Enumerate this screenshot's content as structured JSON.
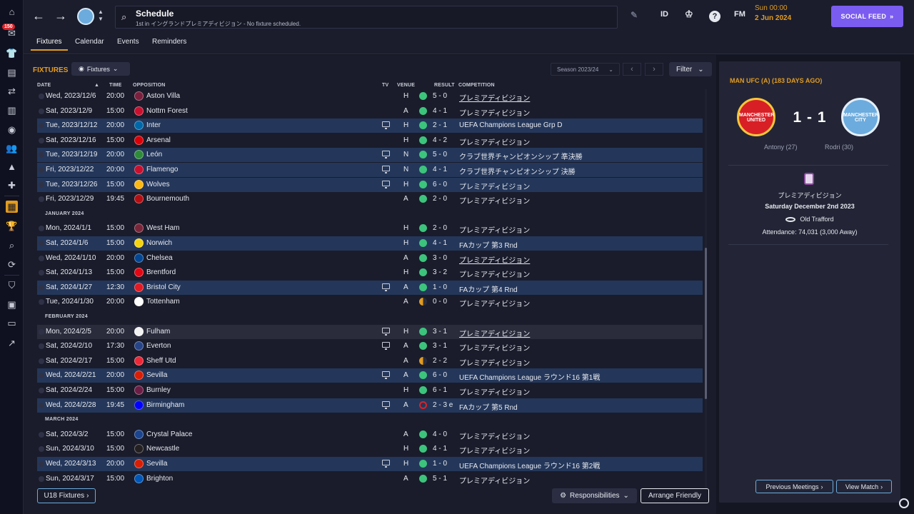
{
  "header": {
    "title": "Schedule",
    "subtitle": "1st in イングランドプレミアディビジョン - No fixture scheduled.",
    "lang_code": "ID",
    "fm_label": "FM",
    "date_day": "Sun 00:00",
    "date_full": "2 Jun 2024",
    "social_label": "SOCIAL FEED",
    "notification_count": "150"
  },
  "tabs": [
    "Fixtures",
    "Calendar",
    "Events",
    "Reminders"
  ],
  "toolbar": {
    "section_title": "FIXTURES",
    "view_label": "Fixtures",
    "season_label": "Season 2023/24",
    "filter_label": "Filter"
  },
  "columns": [
    "DATE",
    "TIME",
    "OPPOSITION",
    "TV",
    "VENUE",
    "RESULT",
    "COMPETITION"
  ],
  "months": [
    "JANUARY 2024",
    "FEBRUARY 2024",
    "MARCH 2024"
  ],
  "fixtures": [
    {
      "date": "Wed, 2023/12/6",
      "time": "20:00",
      "opp": "Aston Villa",
      "tv": false,
      "venue": "H",
      "result": "5 - 0",
      "outcome": "win",
      "comp": "プレミアディビジョン",
      "link": true,
      "crest": "#7a1f3d"
    },
    {
      "date": "Sat, 2023/12/9",
      "time": "15:00",
      "opp": "Nottm Forest",
      "tv": false,
      "venue": "A",
      "result": "4 - 1",
      "outcome": "win",
      "comp": "プレミアディビジョン",
      "link": false,
      "crest": "#c8102e"
    },
    {
      "date": "Tue, 2023/12/12",
      "time": "20:00",
      "opp": "Inter",
      "tv": true,
      "venue": "H",
      "result": "2 - 1",
      "outcome": "win",
      "comp": "UEFA Champions League Grp D",
      "link": false,
      "crest": "#0068a8"
    },
    {
      "date": "Sat, 2023/12/16",
      "time": "15:00",
      "opp": "Arsenal",
      "tv": false,
      "venue": "H",
      "result": "4 - 2",
      "outcome": "win",
      "comp": "プレミアディビジョン",
      "link": false,
      "crest": "#db0007"
    },
    {
      "date": "Tue, 2023/12/19",
      "time": "20:00",
      "opp": "León",
      "tv": true,
      "venue": "N",
      "result": "5 - 0",
      "outcome": "win",
      "comp": "クラブ世界チャンピオンシップ 準決勝",
      "link": false,
      "crest": "#2e8b3a"
    },
    {
      "date": "Fri, 2023/12/22",
      "time": "20:00",
      "opp": "Flamengo",
      "tv": true,
      "venue": "N",
      "result": "4 - 1",
      "outcome": "win",
      "comp": "クラブ世界チャンピオンシップ 決勝",
      "link": false,
      "crest": "#c8102e"
    },
    {
      "date": "Tue, 2023/12/26",
      "time": "15:00",
      "opp": "Wolves",
      "tv": true,
      "venue": "H",
      "result": "6 - 0",
      "outcome": "win",
      "comp": "プレミアディビジョン",
      "link": false,
      "crest": "#fdb913"
    },
    {
      "date": "Fri, 2023/12/29",
      "time": "19:45",
      "opp": "Bournemouth",
      "tv": false,
      "venue": "A",
      "result": "2 - 0",
      "outcome": "win",
      "comp": "プレミアディビジョン",
      "link": false,
      "crest": "#b50e12"
    },
    {
      "date": "Mon, 2024/1/1",
      "time": "15:00",
      "opp": "West Ham",
      "tv": false,
      "venue": "H",
      "result": "2 - 0",
      "outcome": "win",
      "comp": "プレミアディビジョン",
      "link": false,
      "crest": "#7a263a"
    },
    {
      "date": "Sat, 2024/1/6",
      "time": "15:00",
      "opp": "Norwich",
      "tv": false,
      "venue": "H",
      "result": "4 - 1",
      "outcome": "win",
      "comp": "FAカップ 第3 Rnd",
      "link": false,
      "crest": "#f5d40f"
    },
    {
      "date": "Wed, 2024/1/10",
      "time": "20:00",
      "opp": "Chelsea",
      "tv": false,
      "venue": "A",
      "result": "3 - 0",
      "outcome": "win",
      "comp": "プレミアディビジョン",
      "link": true,
      "crest": "#034694"
    },
    {
      "date": "Sat, 2024/1/13",
      "time": "15:00",
      "opp": "Brentford",
      "tv": false,
      "venue": "H",
      "result": "3 - 2",
      "outcome": "win",
      "comp": "プレミアディビジョン",
      "link": false,
      "crest": "#e30613"
    },
    {
      "date": "Sat, 2024/1/27",
      "time": "12:30",
      "opp": "Bristol City",
      "tv": true,
      "venue": "A",
      "result": "1 - 0",
      "outcome": "win",
      "comp": "FAカップ 第4 Rnd",
      "link": false,
      "crest": "#e21a23"
    },
    {
      "date": "Tue, 2024/1/30",
      "time": "20:00",
      "opp": "Tottenham",
      "tv": false,
      "venue": "A",
      "result": "0 - 0",
      "outcome": "draw",
      "comp": "プレミアディビジョン",
      "link": false,
      "crest": "#ffffff"
    },
    {
      "date": "Mon, 2024/2/5",
      "time": "20:00",
      "opp": "Fulham",
      "tv": true,
      "venue": "H",
      "result": "3 - 1",
      "outcome": "win",
      "comp": "プレミアディビジョン",
      "link": true,
      "crest": "#f2f2f2"
    },
    {
      "date": "Sat, 2024/2/10",
      "time": "17:30",
      "opp": "Everton",
      "tv": true,
      "venue": "A",
      "result": "3 - 1",
      "outcome": "win",
      "comp": "プレミアディビジョン",
      "link": false,
      "crest": "#274488"
    },
    {
      "date": "Sat, 2024/2/17",
      "time": "15:00",
      "opp": "Sheff Utd",
      "tv": false,
      "venue": "A",
      "result": "2 - 2",
      "outcome": "draw",
      "comp": "プレミアディビジョン",
      "link": false,
      "crest": "#ee2737"
    },
    {
      "date": "Wed, 2024/2/21",
      "time": "20:00",
      "opp": "Sevilla",
      "tv": true,
      "venue": "A",
      "result": "6 - 0",
      "outcome": "win",
      "comp": "UEFA Champions League ラウンド16 第1戦",
      "link": false,
      "crest": "#d81e05"
    },
    {
      "date": "Sat, 2024/2/24",
      "time": "15:00",
      "opp": "Burnley",
      "tv": false,
      "venue": "H",
      "result": "6 - 1",
      "outcome": "win",
      "comp": "プレミアディビジョン",
      "link": false,
      "crest": "#6c1d45"
    },
    {
      "date": "Wed, 2024/2/28",
      "time": "19:45",
      "opp": "Birmingham",
      "tv": true,
      "venue": "A",
      "result": "2 - 3 e",
      "outcome": "loss",
      "comp": "FAカップ 第5 Rnd",
      "link": false,
      "crest": "#0000ff"
    },
    {
      "date": "Sat, 2024/3/2",
      "time": "15:00",
      "opp": "Crystal Palace",
      "tv": false,
      "venue": "A",
      "result": "4 - 0",
      "outcome": "win",
      "comp": "プレミアディビジョン",
      "link": false,
      "crest": "#1b458f"
    },
    {
      "date": "Sun, 2024/3/10",
      "time": "15:00",
      "opp": "Newcastle",
      "tv": false,
      "venue": "H",
      "result": "4 - 1",
      "outcome": "win",
      "comp": "プレミアディビジョン",
      "link": false,
      "crest": "#241f20"
    },
    {
      "date": "Wed, 2024/3/13",
      "time": "20:00",
      "opp": "Sevilla",
      "tv": true,
      "venue": "H",
      "result": "1 - 0",
      "outcome": "win",
      "comp": "UEFA Champions League ラウンド16 第2戦",
      "link": false,
      "crest": "#d81e05"
    },
    {
      "date": "Sun, 2024/3/17",
      "time": "15:00",
      "opp": "Brighton",
      "tv": false,
      "venue": "A",
      "result": "5 - 1",
      "outcome": "win",
      "comp": "プレミアディビジョン",
      "link": false,
      "crest": "#0057b8"
    }
  ],
  "bottom": {
    "u18_label": "U18 Fixtures",
    "responsibilities_label": "Responsibilities",
    "arrange_label": "Arrange Friendly"
  },
  "match_panel": {
    "title": "MAN UFC (A) (183 DAYS AGO)",
    "home_crest_text": "MANCHESTER UNITED",
    "away_crest_text": "MANCHESTER CITY",
    "score": "1 - 1",
    "home_scorer": "Antony (27)",
    "away_scorer": "Rodri (30)",
    "competition": "プレミアディビジョン",
    "date": "Saturday December 2nd 2023",
    "stadium": "Old Trafford",
    "attendance": "Attendance: 74,031 (3,000 Away)",
    "prev_label": "Previous Meetings",
    "view_label": "View Match"
  },
  "colors": {
    "accent": "#e39c1f",
    "social": "#7b5cf0",
    "win": "#3cc47c",
    "draw": "#e39c1f",
    "loss": "#d8232a",
    "highlight_row": "#24375a"
  }
}
